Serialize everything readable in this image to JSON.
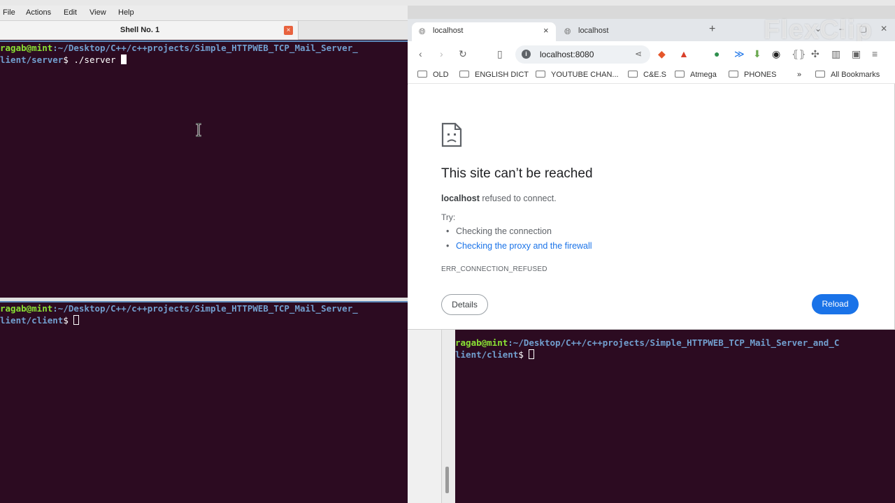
{
  "top_title": "Shell No. 1",
  "terminal": {
    "menu": [
      "File",
      "Actions",
      "Edit",
      "View",
      "Help"
    ],
    "tab_title": "Shell No. 1",
    "close_glyph": "×",
    "pane1": {
      "user_host": "ragab@mint",
      "path_l1": ":~/Desktop/C++/c++projects/Simple_HTTPWEB_TCP_Mail_Server_",
      "path_l2": "lient/server",
      "prompt_cmd": "$ ./server "
    },
    "pane2": {
      "user_host": "ragab@mint",
      "path_l1": ":~/Desktop/C++/c++projects/Simple_HTTPWEB_TCP_Mail_Server_",
      "path_l2": "lient/client",
      "prompt_cmd": "$ "
    }
  },
  "right_terminal": {
    "user_host": "ragab@mint",
    "path_l1": ":~/Desktop/C++/c++projects/Simple_HTTPWEB_TCP_Mail_Server_and_C",
    "path_l2": "lient/client",
    "prompt_cmd": "$ "
  },
  "browser": {
    "tabs": [
      {
        "title": "localhost"
      },
      {
        "title": "localhost"
      }
    ],
    "new_tab_glyph": "+",
    "url": "localhost:8080",
    "bookmarks": [
      "OLD",
      "ENGLISH DICT",
      "YOUTUBE CHAN...",
      "C&E.S",
      "Atmega",
      "PHONES"
    ],
    "bookmarks_more": "»",
    "all_bookmarks": "All Bookmarks",
    "error": {
      "title": "This site can’t be reached",
      "host": "localhost",
      "message": " refused to connect.",
      "try_label": "Try:",
      "suggestions": [
        "Checking the connection",
        "Checking the proxy and the firewall"
      ],
      "code": "ERR_CONNECTION_REFUSED",
      "details_label": "Details",
      "reload_label": "Reload"
    }
  },
  "watermark": "FlexClip",
  "colors": {
    "terminal_bg": "#2c0b21",
    "user": "#8ae234",
    "path": "#729fcf",
    "link": "#1a73e8",
    "reload_btn": "#1a73e8"
  }
}
